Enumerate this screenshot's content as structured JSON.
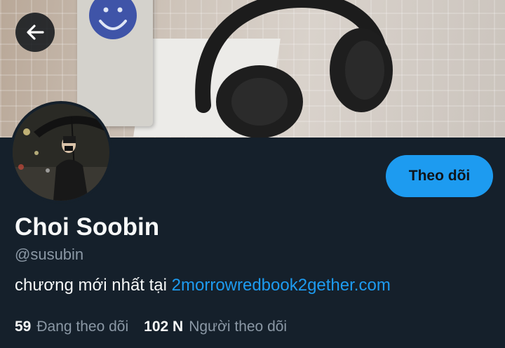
{
  "profile": {
    "display_name": "Choi Soobin",
    "handle": "@susubin",
    "bio_text": "chương mới nhất tại ",
    "bio_link": "2morrowredbook2gether.com",
    "follow_label": "Theo dõi"
  },
  "stats": {
    "following_count": "59",
    "following_label": "Đang theo dõi",
    "followers_count": "102 N",
    "followers_label": "Người theo dõi"
  },
  "colors": {
    "background": "#15202b",
    "accent": "#1d9bf0",
    "secondary_text": "#8b98a5"
  },
  "icons": {
    "back": "arrow-left-icon"
  }
}
